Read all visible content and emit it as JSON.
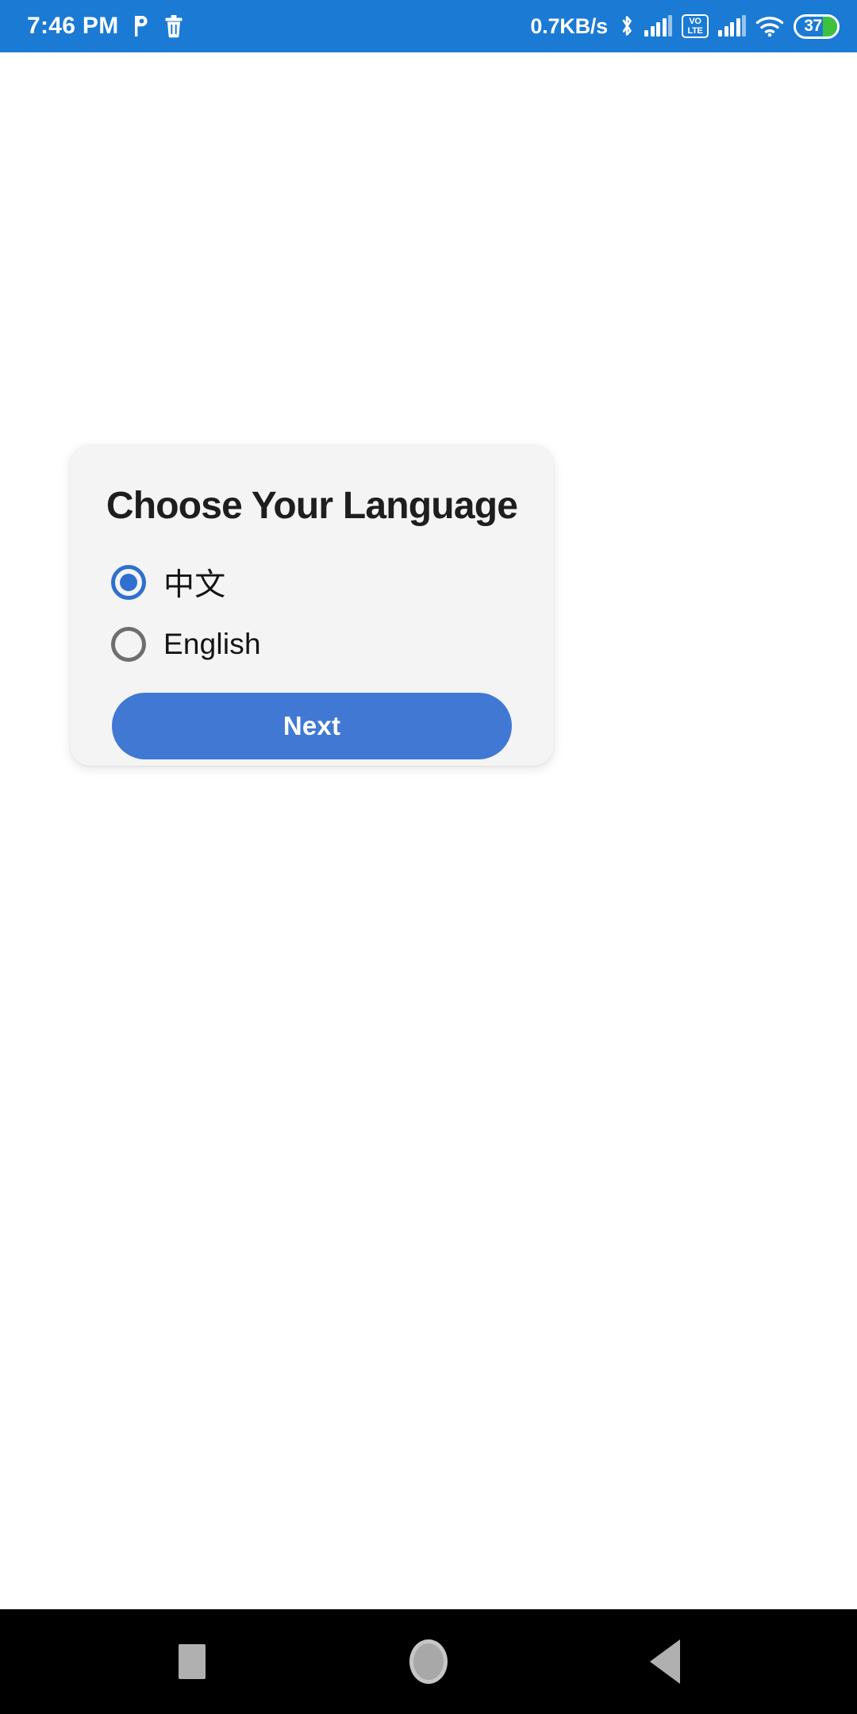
{
  "status_bar": {
    "time": "7:46 PM",
    "network_speed": "0.7KB/s",
    "battery_level": "37",
    "volte_top": "VO",
    "volte_bottom": "LTE",
    "background_color": "#1a7ad4",
    "icons": [
      "parking-p-icon",
      "trash-icon",
      "bluetooth-icon",
      "signal-bars-sim1-icon",
      "volte-icon",
      "signal-bars-sim2-icon",
      "wifi-icon",
      "battery-icon"
    ]
  },
  "card": {
    "title": "Choose Your Language",
    "background_color": "#f4f4f4",
    "options": [
      {
        "label": "中文",
        "selected": true
      },
      {
        "label": "English",
        "selected": false
      }
    ],
    "next_label": "Next",
    "accent_color": "#4178d4",
    "radio_selected_color": "#2f6fd0",
    "radio_unselected_color": "#6e6e6e"
  },
  "nav_bar": {
    "background_color": "#000000",
    "buttons": [
      "recents-button",
      "home-button",
      "back-button"
    ]
  }
}
